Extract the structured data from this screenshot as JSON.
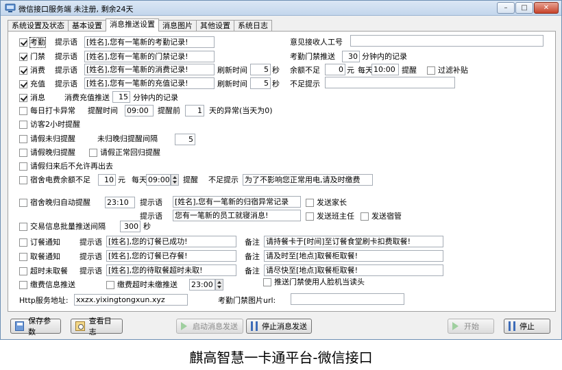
{
  "window": {
    "title": "微信接口服务端 未注册, 剩余24天",
    "minimize_label": "–",
    "maximize_label": "□",
    "close_label": "✕"
  },
  "tabs": [
    {
      "label": "系统设置及状态"
    },
    {
      "label": "基本设置"
    },
    {
      "label": "消息推送设置",
      "active": true
    },
    {
      "label": "消息图片"
    },
    {
      "label": "其他设置"
    },
    {
      "label": "系统日志"
    }
  ],
  "rows": {
    "attendance": {
      "check_label": "考勤",
      "hint_label": "提示语",
      "hint_value": "[姓名],您有一笔新的考勤记录!",
      "receiver_label": "意见接收人工号",
      "receiver_value": ""
    },
    "gate": {
      "check_label": "门禁",
      "hint_label": "提示语",
      "hint_value": "[姓名],您有一笔新的门禁记录!",
      "push_label": "考勤门禁推送",
      "push_value": "30",
      "push_unit": "分钟内的记录"
    },
    "consume": {
      "check_label": "消费",
      "hint_label": "提示语",
      "hint_value": "[姓名],您有一笔新的消费记录!",
      "refresh_label": "刷新时间",
      "refresh_value": "5",
      "refresh_unit": "秒",
      "balance_label": "余额不足",
      "balance_value": "0",
      "balance_unit": "元",
      "daily_label": "每天",
      "daily_value": "10:00",
      "remind_label": "提醒",
      "filter_label": "过滤补贴"
    },
    "recharge": {
      "check_label": "充值",
      "hint_label": "提示语",
      "hint_value": "[姓名],您有一笔新的充值记录!",
      "refresh_label": "刷新时间",
      "refresh_value": "5",
      "refresh_unit": "秒",
      "insufficient_label": "不足提示",
      "insufficient_value": ""
    },
    "message": {
      "check_label": "消息",
      "push_label": "消费充值推送",
      "push_value": "15",
      "push_unit": "分钟内的记录"
    },
    "daily_abnormal": {
      "check_label": "每日打卡异常",
      "remind_time_label": "提醒时间",
      "remind_time_value": "09:00",
      "remind_before_label": "提醒前",
      "days_value": "1",
      "days_unit": "天的异常(当天为0)"
    },
    "visitor": {
      "check_label": "访客2小时提醒"
    },
    "leave_not_return": {
      "check_label": "请假未归提醒",
      "interval_label": "未归晚归提醒间隔",
      "interval_value": "5"
    },
    "leave_late": {
      "check_label": "请假晚归提醒",
      "normal_return_label": "请假正常回归提醒"
    },
    "leave_no_exit": {
      "check_label": "请假归来后不允许再出去"
    },
    "dorm_power": {
      "check_label": "宿舍电费余额不足",
      "amount_value": "10",
      "amount_unit": "元",
      "daily_label": "每天",
      "daily_value": "09:00",
      "remind_label": "提醒",
      "insufficient_label": "不足提示",
      "insufficient_value": "为了不影响您正常用电,请及时缴费"
    },
    "dorm_late": {
      "check_label": "宿舍晚归自动提醒",
      "time_value": "23:10",
      "hint_label": "提示语",
      "hint_value": "[姓名],您有一笔新的归宿异常记录",
      "send_parent_label": "发送家长",
      "hint2_label": "提示语",
      "hint2_value": "您有一笔新的员工就寝消息!",
      "send_teacher_label": "发送班主任",
      "send_dorm_label": "发送宿管"
    },
    "batch_push": {
      "check_label": "交易信息批量推送间隔",
      "interval_value": "300",
      "interval_unit": "秒"
    },
    "order_notice": {
      "check_label": "订餐通知",
      "hint_label": "提示语",
      "hint_value": "[姓名],您的订餐已成功!",
      "note_label": "备注",
      "note_value": "请持餐卡于[时间]至订餐食堂刷卡扣费取餐!"
    },
    "pickup_notice": {
      "check_label": "取餐通知",
      "hint_label": "提示语",
      "hint_value": "[姓名],您的订餐已存餐!",
      "note_label": "备注",
      "note_value": "请及时至[地点]取餐柜取餐!"
    },
    "overdue_pickup": {
      "check_label": "超时未取餐",
      "hint_label": "提示语",
      "hint_value": "[姓名],您的待取餐超时未取!",
      "note_label": "备注",
      "note_value": "请尽快至[地点]取餐柜取餐!"
    },
    "fee_push": {
      "check_label": "缴费信息推送",
      "overdue_label": "缴费超时未缴推送",
      "time_value": "23:00",
      "face_label": "推送门禁使用人脸机当读头"
    },
    "http": {
      "label": "Http服务地址:",
      "value": "xxzx.yixingtongxun.xyz",
      "img_label": "考勤门禁图片url:",
      "img_value": ""
    }
  },
  "buttons": {
    "save": "保存参数",
    "view_log": "查看日志",
    "start_send": "启动消息发送",
    "stop_send": "停止消息发送",
    "start": "开始",
    "stop": "停止"
  },
  "footer_caption": "麒高智慧一卡通平台-微信接口"
}
